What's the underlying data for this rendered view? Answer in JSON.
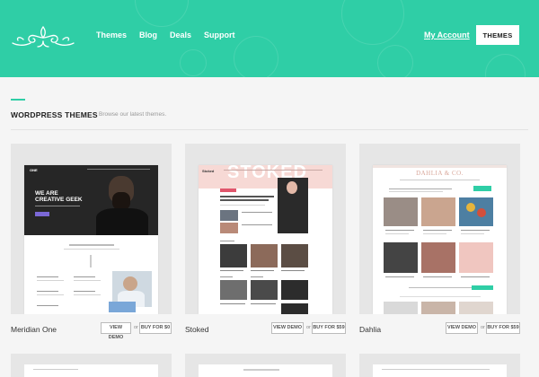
{
  "header": {
    "nav": [
      "Themes",
      "Blog",
      "Deals",
      "Support"
    ],
    "account_label": "My Account",
    "themes_button": "THEMES",
    "colors": {
      "brand": "#2fcea6"
    }
  },
  "section": {
    "title": "WORDPRESS THEMES",
    "subtitle": "Browse our latest themes."
  },
  "cards": [
    {
      "name": "Meridian One",
      "demo_label": "VIEW DEMO",
      "or_label": "or",
      "buy_label": "BUY FOR $0",
      "preview": {
        "brand": "ONE",
        "headline_1": "WE ARE",
        "headline_2": "CREATIVE GEEK"
      }
    },
    {
      "name": "Stoked",
      "demo_label": "VIEW DEMO",
      "or_label": "or",
      "buy_label": "BUY FOR $59",
      "preview": {
        "hero": "STOKED",
        "brand": "Stoked"
      }
    },
    {
      "name": "Dahlia",
      "demo_label": "VIEW DEMO",
      "or_label": "or",
      "buy_label": "BUY FOR $59",
      "preview": {
        "brand": "DAHLIA & CO."
      }
    }
  ]
}
